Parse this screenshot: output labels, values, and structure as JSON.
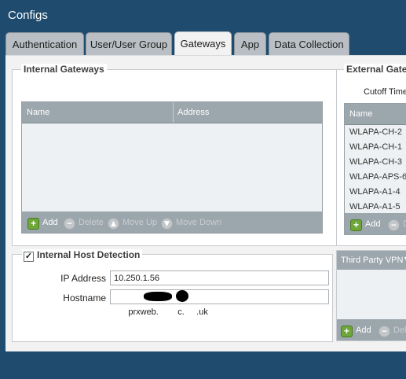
{
  "window": {
    "title": "Configs"
  },
  "tabs": [
    {
      "label": "Authentication"
    },
    {
      "label": "User/User Group"
    },
    {
      "label": "Gateways"
    },
    {
      "label": "App"
    },
    {
      "label": "Data Collection"
    }
  ],
  "active_tab": "Gateways",
  "internal_gateways": {
    "legend": "Internal Gateways",
    "columns": [
      "Name",
      "Address"
    ],
    "footer": {
      "add": "Add",
      "delete": "Delete",
      "move_up": "Move Up",
      "move_down": "Move Down"
    }
  },
  "external_gateways": {
    "legend": "External Gate",
    "cutoff_label": "Cutoff Time",
    "columns": [
      "Name"
    ],
    "rows": [
      "WLAPA-CH-2",
      "WLAPA-CH-1",
      "WLAPA-CH-3",
      "WLAPA-APS-6",
      "WLAPA-A1-4",
      "WLAPA-A1-5"
    ],
    "footer": {
      "add": "Add",
      "delete": "De"
    }
  },
  "third_party_vpn": {
    "header": "Third Party VPN",
    "footer": {
      "add": "Add",
      "delete": "Dele"
    }
  },
  "internal_host_detection": {
    "legend": "Internal Host Detection",
    "checked": true,
    "ip_label": "IP Address",
    "ip_value": "10.250.1.56",
    "hostname_label": "Hostname",
    "hostname_value": "prxweb.        c.     .uk"
  }
}
